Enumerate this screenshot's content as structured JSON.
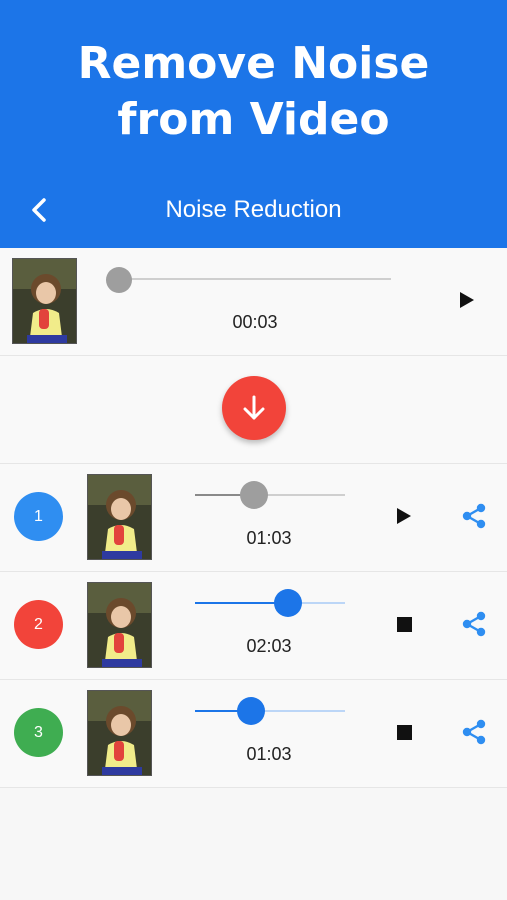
{
  "promo": {
    "headline_line1": "Remove Noise",
    "headline_line2": "from Video"
  },
  "navbar": {
    "title": "Noise Reduction",
    "back_icon": "chevron-left-icon"
  },
  "colors": {
    "primary": "#1c75e8",
    "accent_red": "#f2443a",
    "green": "#3fad51",
    "blue_badge": "#2f8ef1"
  },
  "source": {
    "time": "00:03",
    "progress": 0.0,
    "control": "play"
  },
  "download": {
    "icon": "arrow-down-icon"
  },
  "outputs": [
    {
      "number": "1",
      "badge_color": "#2f8ef1",
      "time": "01:03",
      "progress": 0.39,
      "control": "play",
      "active": false
    },
    {
      "number": "2",
      "badge_color": "#f2443a",
      "time": "02:03",
      "progress": 0.62,
      "control": "stop",
      "active": true
    },
    {
      "number": "3",
      "badge_color": "#3fad51",
      "time": "01:03",
      "progress": 0.37,
      "control": "stop",
      "active": true
    }
  ]
}
